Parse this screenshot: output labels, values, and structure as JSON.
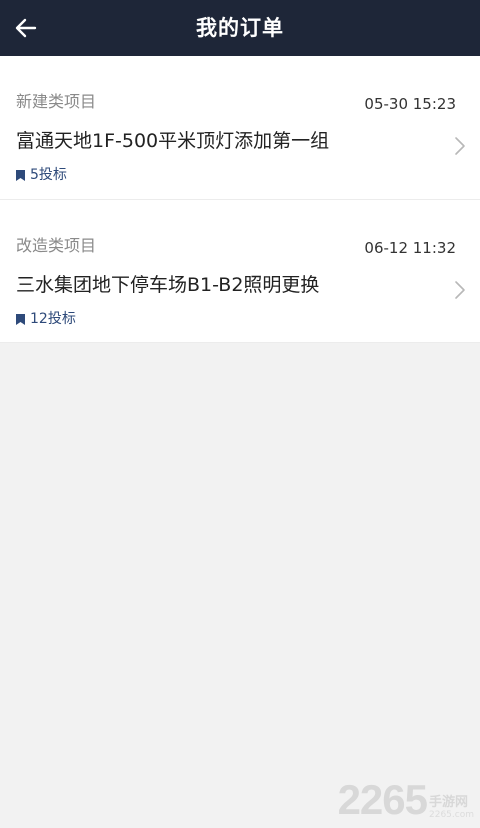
{
  "header": {
    "title": "我的订单",
    "back_icon": "arrow-left-icon",
    "background": "#1e2638"
  },
  "orders": [
    {
      "category": "新建类项目",
      "time": "05-30 15:23",
      "title": "富通天地1F-500平米顶灯添加第一组",
      "bids": "5投标"
    },
    {
      "category": "改造类项目",
      "time": "06-12 11:32",
      "title": "三水集团地下停车场B1-B2照明更换",
      "bids": "12投标"
    }
  ],
  "watermark": {
    "number": "2265",
    "text": "手游网",
    "url": "2265.com"
  },
  "colors": {
    "accent": "#2e4a7a",
    "page_bg": "#f2f2f2"
  }
}
